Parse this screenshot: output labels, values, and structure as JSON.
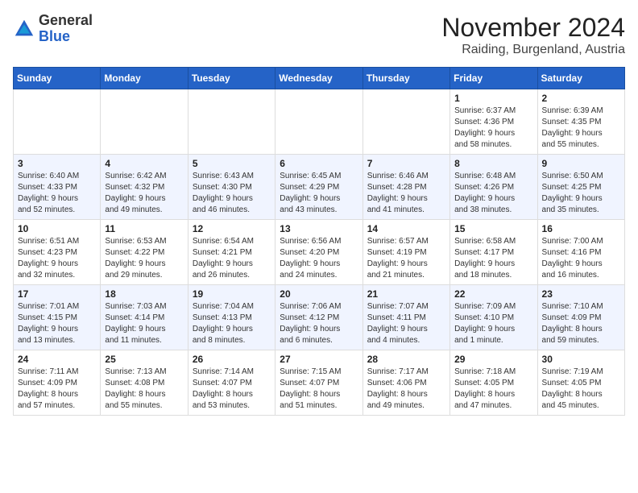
{
  "header": {
    "logo_general": "General",
    "logo_blue": "Blue",
    "month_title": "November 2024",
    "location": "Raiding, Burgenland, Austria"
  },
  "weekdays": [
    "Sunday",
    "Monday",
    "Tuesday",
    "Wednesday",
    "Thursday",
    "Friday",
    "Saturday"
  ],
  "weeks": [
    [
      {
        "day": "",
        "info": ""
      },
      {
        "day": "",
        "info": ""
      },
      {
        "day": "",
        "info": ""
      },
      {
        "day": "",
        "info": ""
      },
      {
        "day": "",
        "info": ""
      },
      {
        "day": "1",
        "info": "Sunrise: 6:37 AM\nSunset: 4:36 PM\nDaylight: 9 hours\nand 58 minutes."
      },
      {
        "day": "2",
        "info": "Sunrise: 6:39 AM\nSunset: 4:35 PM\nDaylight: 9 hours\nand 55 minutes."
      }
    ],
    [
      {
        "day": "3",
        "info": "Sunrise: 6:40 AM\nSunset: 4:33 PM\nDaylight: 9 hours\nand 52 minutes."
      },
      {
        "day": "4",
        "info": "Sunrise: 6:42 AM\nSunset: 4:32 PM\nDaylight: 9 hours\nand 49 minutes."
      },
      {
        "day": "5",
        "info": "Sunrise: 6:43 AM\nSunset: 4:30 PM\nDaylight: 9 hours\nand 46 minutes."
      },
      {
        "day": "6",
        "info": "Sunrise: 6:45 AM\nSunset: 4:29 PM\nDaylight: 9 hours\nand 43 minutes."
      },
      {
        "day": "7",
        "info": "Sunrise: 6:46 AM\nSunset: 4:28 PM\nDaylight: 9 hours\nand 41 minutes."
      },
      {
        "day": "8",
        "info": "Sunrise: 6:48 AM\nSunset: 4:26 PM\nDaylight: 9 hours\nand 38 minutes."
      },
      {
        "day": "9",
        "info": "Sunrise: 6:50 AM\nSunset: 4:25 PM\nDaylight: 9 hours\nand 35 minutes."
      }
    ],
    [
      {
        "day": "10",
        "info": "Sunrise: 6:51 AM\nSunset: 4:23 PM\nDaylight: 9 hours\nand 32 minutes."
      },
      {
        "day": "11",
        "info": "Sunrise: 6:53 AM\nSunset: 4:22 PM\nDaylight: 9 hours\nand 29 minutes."
      },
      {
        "day": "12",
        "info": "Sunrise: 6:54 AM\nSunset: 4:21 PM\nDaylight: 9 hours\nand 26 minutes."
      },
      {
        "day": "13",
        "info": "Sunrise: 6:56 AM\nSunset: 4:20 PM\nDaylight: 9 hours\nand 24 minutes."
      },
      {
        "day": "14",
        "info": "Sunrise: 6:57 AM\nSunset: 4:19 PM\nDaylight: 9 hours\nand 21 minutes."
      },
      {
        "day": "15",
        "info": "Sunrise: 6:58 AM\nSunset: 4:17 PM\nDaylight: 9 hours\nand 18 minutes."
      },
      {
        "day": "16",
        "info": "Sunrise: 7:00 AM\nSunset: 4:16 PM\nDaylight: 9 hours\nand 16 minutes."
      }
    ],
    [
      {
        "day": "17",
        "info": "Sunrise: 7:01 AM\nSunset: 4:15 PM\nDaylight: 9 hours\nand 13 minutes."
      },
      {
        "day": "18",
        "info": "Sunrise: 7:03 AM\nSunset: 4:14 PM\nDaylight: 9 hours\nand 11 minutes."
      },
      {
        "day": "19",
        "info": "Sunrise: 7:04 AM\nSunset: 4:13 PM\nDaylight: 9 hours\nand 8 minutes."
      },
      {
        "day": "20",
        "info": "Sunrise: 7:06 AM\nSunset: 4:12 PM\nDaylight: 9 hours\nand 6 minutes."
      },
      {
        "day": "21",
        "info": "Sunrise: 7:07 AM\nSunset: 4:11 PM\nDaylight: 9 hours\nand 4 minutes."
      },
      {
        "day": "22",
        "info": "Sunrise: 7:09 AM\nSunset: 4:10 PM\nDaylight: 9 hours\nand 1 minute."
      },
      {
        "day": "23",
        "info": "Sunrise: 7:10 AM\nSunset: 4:09 PM\nDaylight: 8 hours\nand 59 minutes."
      }
    ],
    [
      {
        "day": "24",
        "info": "Sunrise: 7:11 AM\nSunset: 4:09 PM\nDaylight: 8 hours\nand 57 minutes."
      },
      {
        "day": "25",
        "info": "Sunrise: 7:13 AM\nSunset: 4:08 PM\nDaylight: 8 hours\nand 55 minutes."
      },
      {
        "day": "26",
        "info": "Sunrise: 7:14 AM\nSunset: 4:07 PM\nDaylight: 8 hours\nand 53 minutes."
      },
      {
        "day": "27",
        "info": "Sunrise: 7:15 AM\nSunset: 4:07 PM\nDaylight: 8 hours\nand 51 minutes."
      },
      {
        "day": "28",
        "info": "Sunrise: 7:17 AM\nSunset: 4:06 PM\nDaylight: 8 hours\nand 49 minutes."
      },
      {
        "day": "29",
        "info": "Sunrise: 7:18 AM\nSunset: 4:05 PM\nDaylight: 8 hours\nand 47 minutes."
      },
      {
        "day": "30",
        "info": "Sunrise: 7:19 AM\nSunset: 4:05 PM\nDaylight: 8 hours\nand 45 minutes."
      }
    ]
  ]
}
